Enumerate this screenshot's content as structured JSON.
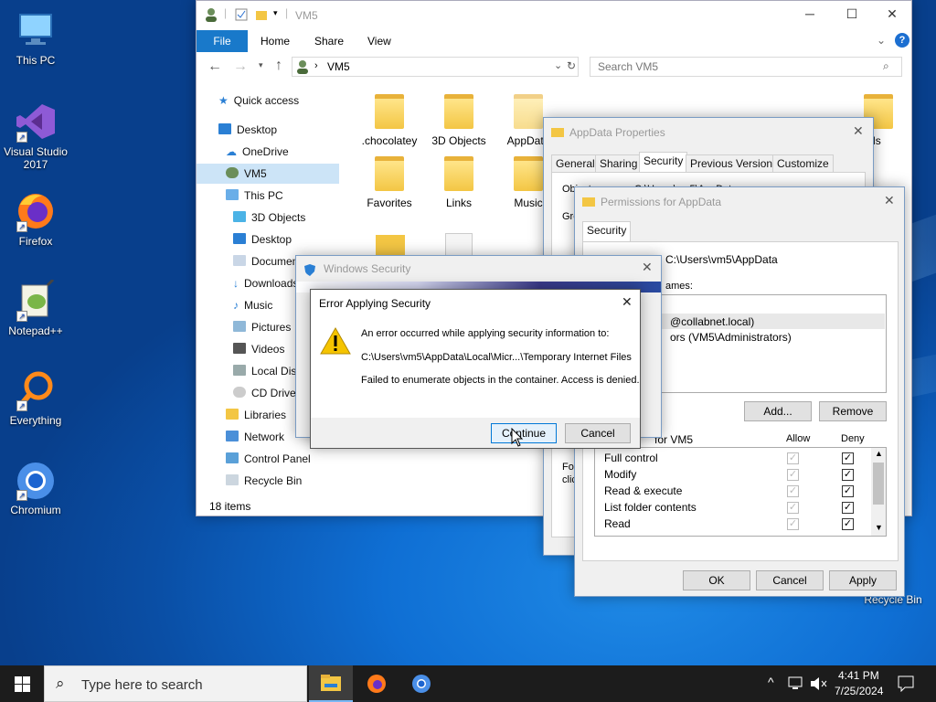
{
  "desktop": {
    "icons": [
      {
        "label": "This PC",
        "icon": "monitor-icon"
      },
      {
        "label": "Visual Studio 2017",
        "icon": "visual-studio-icon"
      },
      {
        "label": "Firefox",
        "icon": "firefox-icon"
      },
      {
        "label": "Notepad++",
        "icon": "notepadpp-icon"
      },
      {
        "label": "Everything",
        "icon": "search-magnifier-icon"
      },
      {
        "label": "Chromium",
        "icon": "chromium-icon"
      },
      {
        "label": "Recycle Bin",
        "icon": "recycle-bin-icon"
      }
    ]
  },
  "explorer": {
    "title": "VM5",
    "ribbon_tabs": [
      "File",
      "Home",
      "Share",
      "View"
    ],
    "address": "VM5",
    "search_placeholder": "Search VM5",
    "nav": [
      "Quick access",
      "Desktop",
      "OneDrive",
      "VM5",
      "This PC",
      "3D Objects",
      "Desktop",
      "Documents",
      "Downloads",
      "Music",
      "Pictures",
      "Videos",
      "Local Disk",
      "CD Drive",
      "Libraries",
      "Network",
      "Control Panel",
      "Recycle Bin"
    ],
    "items": [
      ".chocolatey",
      "3D Objects",
      "AppData",
      "Favorites",
      "Links",
      "Music",
      "loads"
    ],
    "status": "18 items"
  },
  "appdata_props": {
    "title": "AppData Properties",
    "tabs": [
      "General",
      "Sharing",
      "Security",
      "Previous Versions",
      "Customize"
    ],
    "fragments": [
      "Object name:",
      "C:\\Users\\vm5\\AppData",
      "Gro",
      "For",
      "clic"
    ]
  },
  "permissions": {
    "title": "Permissions for AppData",
    "tab": "Security",
    "object_path": "C:\\Users\\vm5\\AppData",
    "names_label": "ames:",
    "principals": [
      "@collabnet.local)",
      "ors (VM5\\Administrators)"
    ],
    "add": "Add...",
    "remove": "Remove",
    "perm_label": "for VM5",
    "allow": "Allow",
    "deny": "Deny",
    "perms": [
      "Full control",
      "Modify",
      "Read & execute",
      "List folder contents",
      "Read"
    ],
    "ok": "OK",
    "cancel": "Cancel",
    "apply": "Apply"
  },
  "winsec": {
    "title": "Windows Security"
  },
  "error_dialog": {
    "title": "Error Applying Security",
    "line1": "An error occurred while applying security information to:",
    "path": "C:\\Users\\vm5\\AppData\\Local\\Micr...\\Temporary Internet Files",
    "line2": "Failed to enumerate objects in the container. Access is denied.",
    "continue": "Continue",
    "cancel": "Cancel"
  },
  "taskbar": {
    "search_placeholder": "Type here to search",
    "time": "4:41 PM",
    "date": "7/25/2024"
  },
  "colors": {
    "accent": "#0078d7",
    "taskbar": "#1c1c1c",
    "folder": "#f3c644"
  }
}
